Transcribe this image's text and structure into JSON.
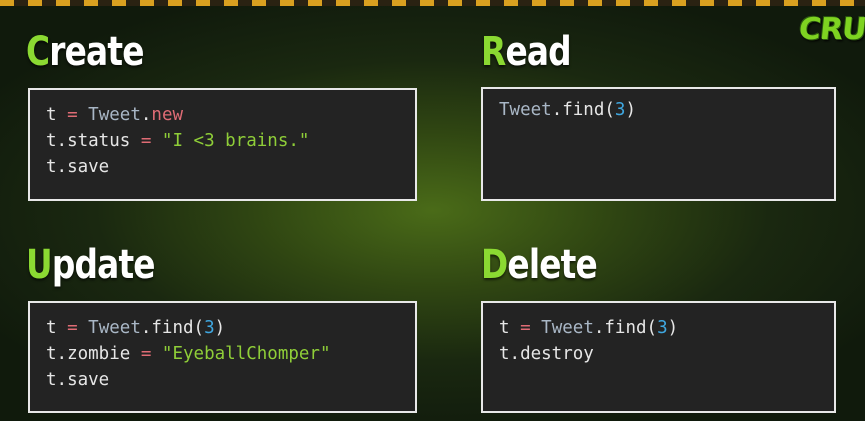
{
  "panels": [
    {
      "id": "create",
      "heading_first": "C",
      "heading_rest": "reate",
      "lines": [
        [
          {
            "t": "t ",
            "c": "plain"
          },
          {
            "t": "=",
            "c": "op"
          },
          {
            "t": " ",
            "c": "plain"
          },
          {
            "t": "Tweet",
            "c": "class"
          },
          {
            "t": ".",
            "c": "plain"
          },
          {
            "t": "new",
            "c": "method"
          }
        ],
        [
          {
            "t": "t.status ",
            "c": "plain"
          },
          {
            "t": "=",
            "c": "op"
          },
          {
            "t": " ",
            "c": "plain"
          },
          {
            "t": "\"I <3 brains.\"",
            "c": "str"
          }
        ],
        [
          {
            "t": "t.save",
            "c": "plain"
          }
        ]
      ]
    },
    {
      "id": "read",
      "heading_first": "R",
      "heading_rest": "ead",
      "lines": [
        [
          {
            "t": "Tweet",
            "c": "class"
          },
          {
            "t": ".find(",
            "c": "plain"
          },
          {
            "t": "3",
            "c": "num"
          },
          {
            "t": ")",
            "c": "plain"
          }
        ]
      ]
    },
    {
      "id": "update",
      "heading_first": "U",
      "heading_rest": "pdate",
      "lines": [
        [
          {
            "t": "t ",
            "c": "plain"
          },
          {
            "t": "=",
            "c": "op"
          },
          {
            "t": " ",
            "c": "plain"
          },
          {
            "t": "Tweet",
            "c": "class"
          },
          {
            "t": ".find(",
            "c": "plain"
          },
          {
            "t": "3",
            "c": "num"
          },
          {
            "t": ")",
            "c": "plain"
          }
        ],
        [
          {
            "t": "t.zombie ",
            "c": "plain"
          },
          {
            "t": "=",
            "c": "op"
          },
          {
            "t": " ",
            "c": "plain"
          },
          {
            "t": "\"EyeballChomper\"",
            "c": "str"
          }
        ],
        [
          {
            "t": "t.save",
            "c": "plain"
          }
        ]
      ]
    },
    {
      "id": "delete",
      "heading_first": "D",
      "heading_rest": "elete",
      "lines": [
        [
          {
            "t": "t ",
            "c": "plain"
          },
          {
            "t": "=",
            "c": "op"
          },
          {
            "t": " ",
            "c": "plain"
          },
          {
            "t": "Tweet",
            "c": "class"
          },
          {
            "t": ".find(",
            "c": "plain"
          },
          {
            "t": "3",
            "c": "num"
          },
          {
            "t": ")",
            "c": "plain"
          }
        ],
        [
          {
            "t": "t.destroy",
            "c": "plain"
          }
        ]
      ]
    }
  ],
  "logo": {
    "text": "CRU"
  },
  "colors": {
    "accent_green": "#8bd932",
    "code_background": "#232323",
    "string": "#8fce38",
    "number": "#3fa7e0",
    "operator": "#e06c75",
    "class_name": "#a9b7c6"
  }
}
